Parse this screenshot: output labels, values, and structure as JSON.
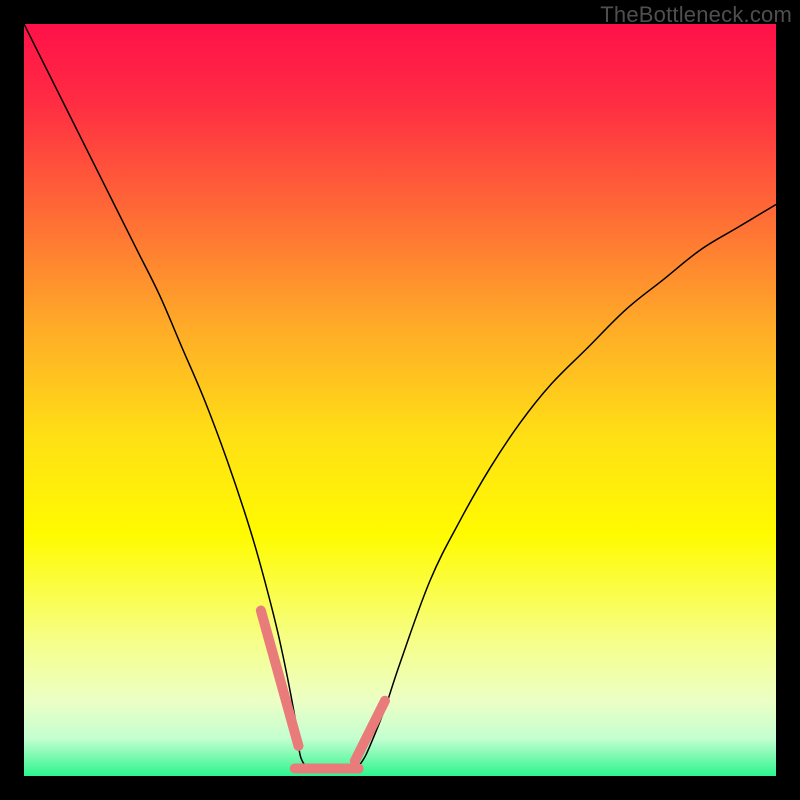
{
  "watermark": "TheBottleneck.com",
  "chart_data": {
    "type": "line",
    "title": "",
    "xlabel": "",
    "ylabel": "",
    "xlim": [
      0,
      100
    ],
    "ylim": [
      0,
      100
    ],
    "grid": false,
    "background": {
      "type": "vertical-gradient",
      "stops": [
        {
          "pos": 0.0,
          "color": "#ff1149"
        },
        {
          "pos": 0.1,
          "color": "#ff2b43"
        },
        {
          "pos": 0.25,
          "color": "#ff6a36"
        },
        {
          "pos": 0.4,
          "color": "#ffaa28"
        },
        {
          "pos": 0.55,
          "color": "#ffe015"
        },
        {
          "pos": 0.68,
          "color": "#fffb00"
        },
        {
          "pos": 0.82,
          "color": "#f6ff88"
        },
        {
          "pos": 0.9,
          "color": "#ecffc5"
        },
        {
          "pos": 0.95,
          "color": "#c4ffd0"
        },
        {
          "pos": 1.0,
          "color": "#2cf58e"
        }
      ]
    },
    "series": [
      {
        "name": "bottleneck-curve",
        "color": "#000000",
        "width": 1.5,
        "x": [
          0,
          3,
          6,
          9,
          12,
          15,
          18,
          21,
          24,
          27,
          30,
          32,
          34,
          36,
          36.5,
          37,
          38,
          40,
          42,
          44,
          45,
          46,
          48,
          50,
          54,
          58,
          62,
          66,
          70,
          75,
          80,
          85,
          90,
          95,
          100
        ],
        "y": [
          100,
          94,
          88,
          82,
          76,
          70,
          64,
          57,
          50,
          42,
          33,
          26,
          18,
          8,
          4,
          2,
          1,
          0.5,
          0.5,
          1,
          2,
          4,
          9,
          15,
          26,
          34,
          41,
          47,
          52,
          57,
          62,
          66,
          70,
          73,
          76
        ]
      }
    ],
    "highlights": [
      {
        "name": "left-tip",
        "color": "#e97b7b",
        "width": 10,
        "x": [
          31.5,
          36.5
        ],
        "y": [
          22,
          4
        ]
      },
      {
        "name": "valley",
        "color": "#e97b7b",
        "width": 10,
        "x": [
          36.0,
          44.5
        ],
        "y": [
          1.0,
          1.0
        ]
      },
      {
        "name": "right-tip",
        "color": "#e97b7b",
        "width": 10,
        "x": [
          44.0,
          48.0
        ],
        "y": [
          2,
          10
        ]
      }
    ]
  }
}
